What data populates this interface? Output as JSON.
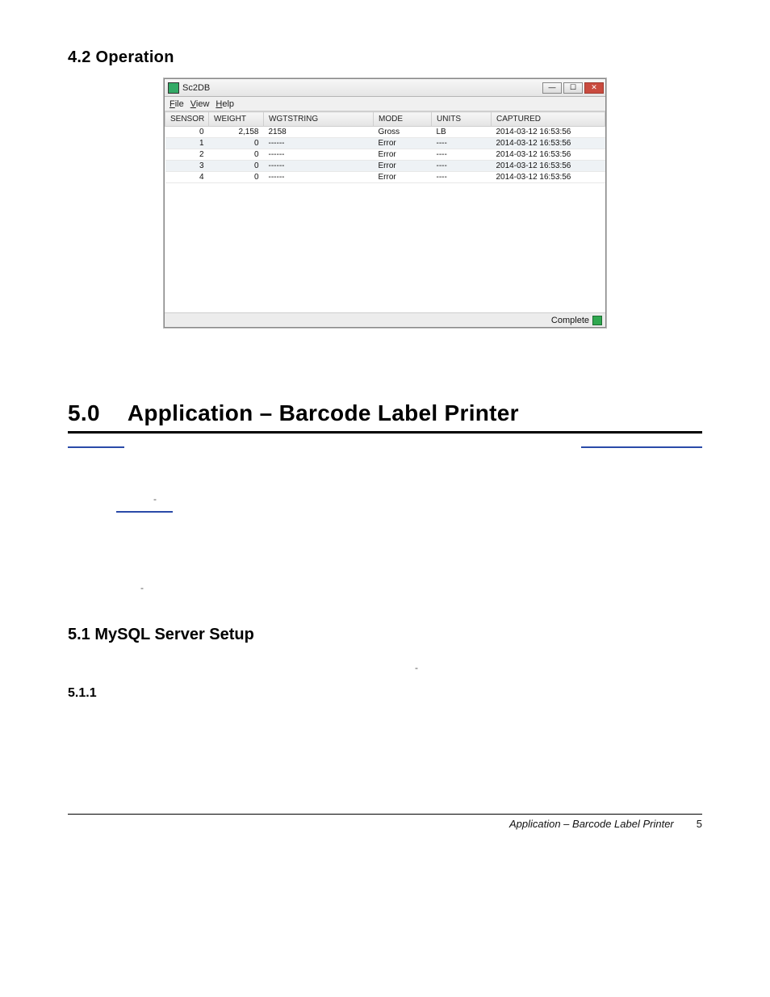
{
  "section42": "4.2  Operation",
  "window": {
    "title": "Sc2DB",
    "icons": {
      "min": "minimize-icon",
      "max": "maximize-icon",
      "close": "close-icon"
    },
    "glyphs": {
      "min": "—",
      "max": "☐",
      "close": "✕"
    },
    "menu": {
      "file": "File",
      "view": "View",
      "help": "Help",
      "file_u": "F",
      "view_u": "V",
      "help_u": "H"
    },
    "columns": [
      "SENSOR",
      "WEIGHT",
      "WGTSTRING",
      "MODE",
      "UNITS",
      "CAPTURED"
    ],
    "rows": [
      {
        "sensor": "0",
        "weight": "2,158",
        "wgtstring": "2158",
        "mode": "Gross",
        "units": "LB",
        "captured": "2014-03-12 16:53:56"
      },
      {
        "sensor": "1",
        "weight": "0",
        "wgtstring": "------",
        "mode": "Error",
        "units": "----",
        "captured": "2014-03-12 16:53:56"
      },
      {
        "sensor": "2",
        "weight": "0",
        "wgtstring": "------",
        "mode": "Error",
        "units": "----",
        "captured": "2014-03-12 16:53:56"
      },
      {
        "sensor": "3",
        "weight": "0",
        "wgtstring": "------",
        "mode": "Error",
        "units": "----",
        "captured": "2014-03-12 16:53:56"
      },
      {
        "sensor": "4",
        "weight": "0",
        "wgtstring": "------",
        "mode": "Error",
        "units": "----",
        "captured": "2014-03-12 16:53:56"
      }
    ],
    "status": "Complete"
  },
  "section50": {
    "num": "5.0",
    "title": "Application – Barcode Label Printer"
  },
  "dashes": {
    "d1": "-",
    "d2": "-",
    "d3": "-"
  },
  "section51": "5.1  MySQL Server Setup",
  "section511": "5.1.1",
  "footer": {
    "text": "Application – Barcode Label Printer",
    "page": "5"
  }
}
